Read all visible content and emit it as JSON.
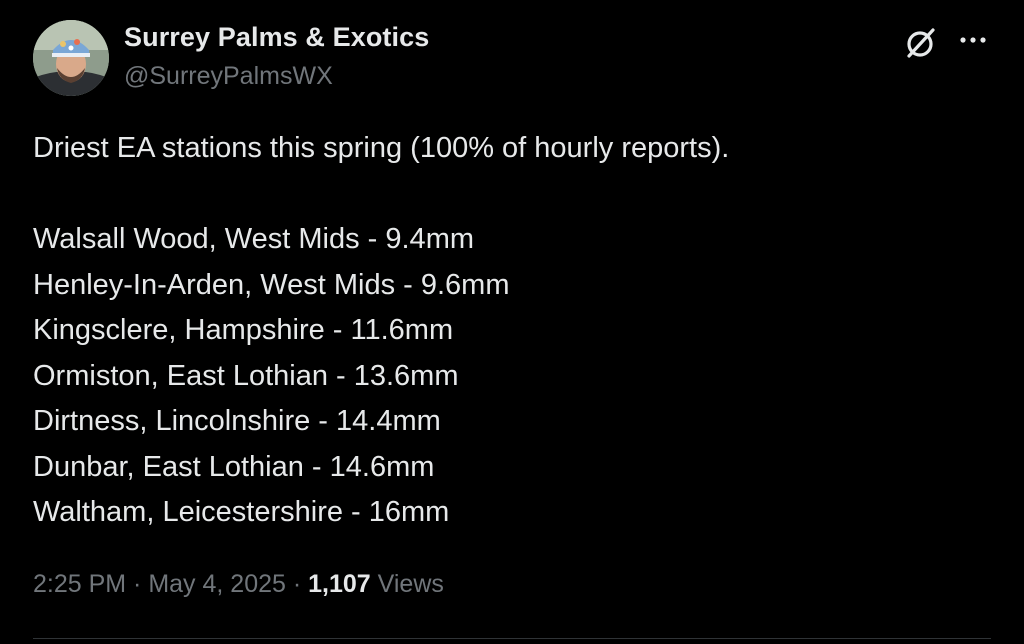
{
  "author": {
    "display_name": "Surrey Palms & Exotics",
    "handle": "@SurreyPalmsWX"
  },
  "header_icons": {
    "grok": "grok-icon",
    "more": "more-dots-icon"
  },
  "tweet": {
    "intro": "Driest EA stations this spring (100% of hourly reports).",
    "stations": [
      "Walsall Wood, West Mids - 9.4mm",
      "Henley-In-Arden, West Mids - 9.6mm",
      "Kingsclere, Hampshire - 11.6mm",
      "Ormiston, East Lothian - 13.6mm",
      "Dirtness, Lincolnshire - 14.4mm",
      "Dunbar, East Lothian - 14.6mm",
      "Waltham, Leicestershire - 16mm"
    ]
  },
  "meta": {
    "time": "2:25 PM",
    "separator": " · ",
    "date": "May 4, 2025",
    "views_count": "1,107",
    "views_label": " Views"
  },
  "colors": {
    "background": "#000000",
    "primary_text": "#e7e9ea",
    "secondary_text": "#71767b",
    "divider": "#2f3336"
  }
}
